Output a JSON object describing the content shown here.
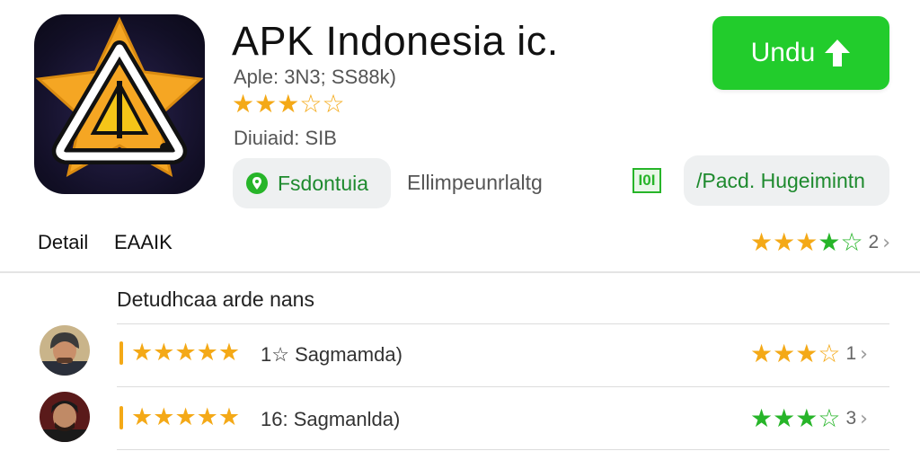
{
  "app": {
    "title": "APK Indonesia ic.",
    "meta": "Aple: 3N3; SS88k)",
    "size": "Diuiaid: SIB",
    "rating_stars": [
      "full",
      "full",
      "full",
      "half",
      "empty"
    ]
  },
  "download_button": {
    "label": "Undu"
  },
  "chips": {
    "left_label": "Fsdontuia",
    "middle_text": "Ellimpeunrlaltg",
    "badge_text": "I0I",
    "right_label": "/Pacd. Hugeimintn"
  },
  "tabs": {
    "detail": "Detail",
    "second": "EAAIK"
  },
  "header_rating": {
    "stars": [
      "full",
      "full",
      "full",
      "g-half",
      "g-empty"
    ],
    "count": "2"
  },
  "reviews": {
    "section_title": "Detudhcaa arde nans",
    "items": [
      {
        "text": "1☆ Sagmamda)",
        "stars": 5,
        "rating_stars": [
          "full",
          "full",
          "half",
          "empty"
        ],
        "rating_count": "1"
      },
      {
        "text": "16: Sagmanlda)",
        "stars": 5,
        "rating_stars": [
          "g-full",
          "g-full",
          "g-half",
          "g-empty"
        ],
        "rating_count": "3"
      }
    ]
  },
  "colors": {
    "accent_green": "#22cc2c",
    "star_gold": "#f4a917",
    "star_green": "#27b529"
  }
}
